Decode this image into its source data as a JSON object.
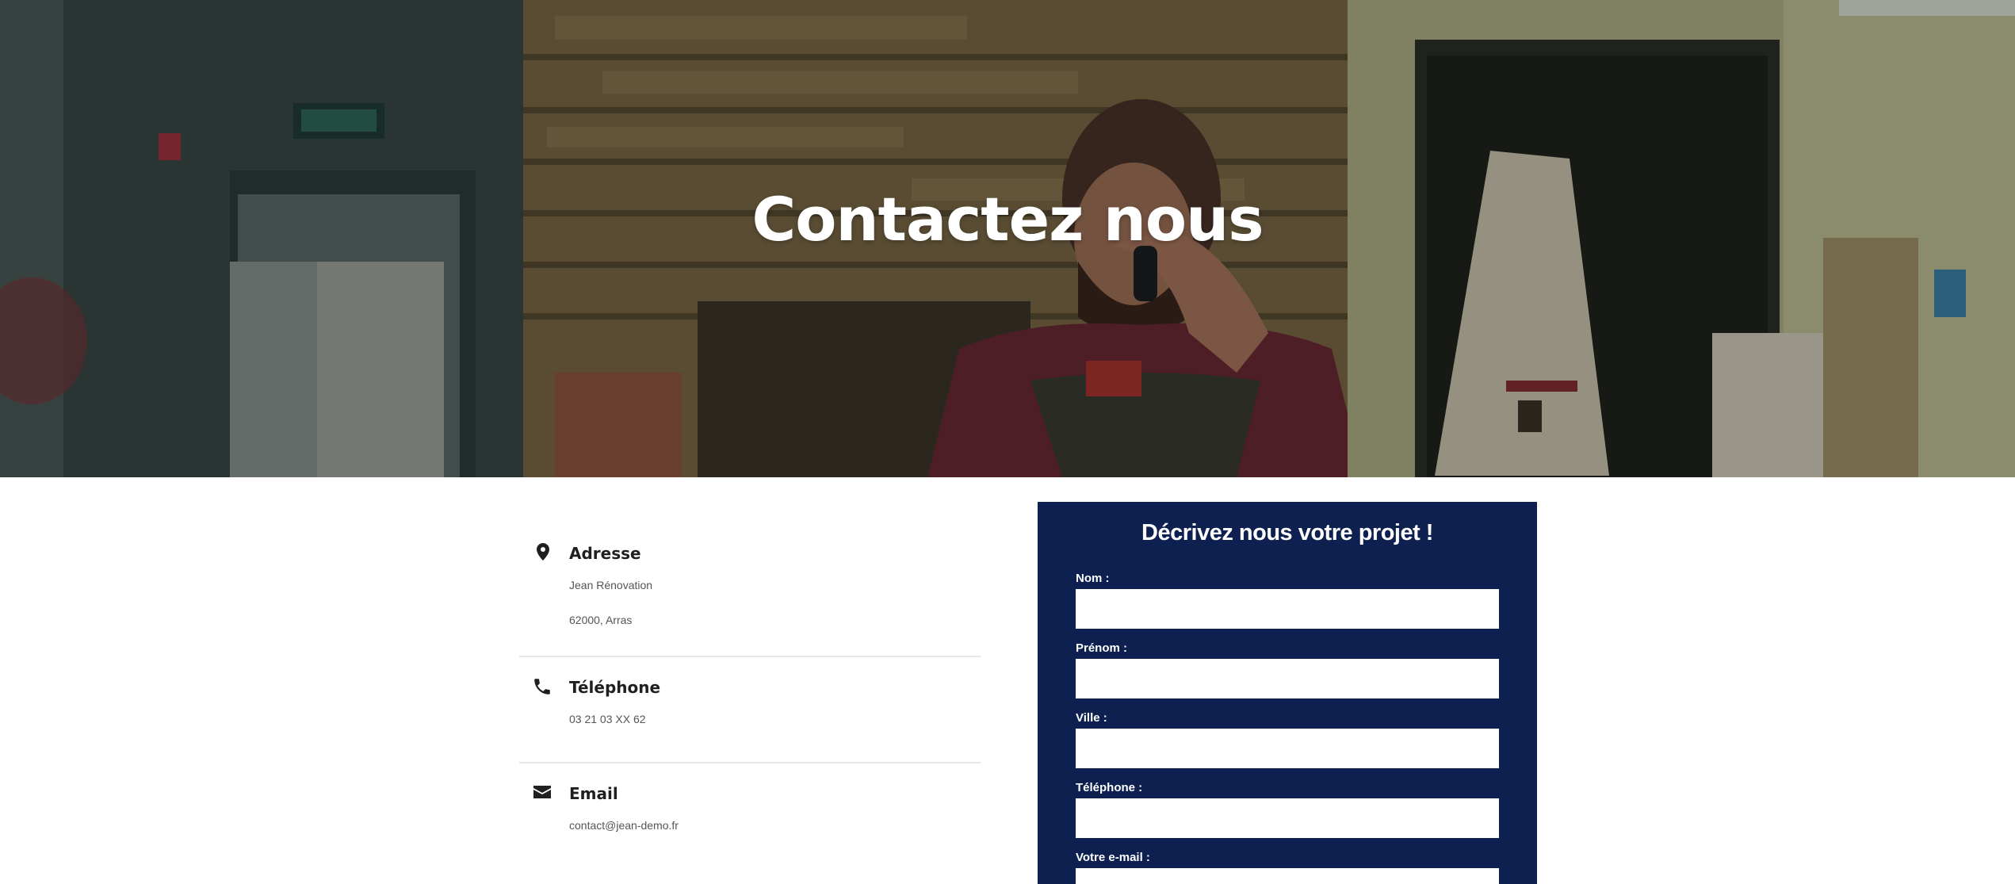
{
  "hero": {
    "title": "Contactez nous"
  },
  "contact": {
    "address": {
      "icon": "map-pin-icon",
      "title": "Adresse",
      "line1": "Jean Rénovation",
      "line2": "62000, Arras"
    },
    "phone": {
      "icon": "phone-icon",
      "title": "Téléphone",
      "value": "03 21 03 XX 62"
    },
    "email": {
      "icon": "envelope-icon",
      "title": "Email",
      "value": "contact@jean-demo.fr"
    }
  },
  "form": {
    "title": "Décrivez nous votre projet !",
    "fields": [
      {
        "label": "Nom :",
        "value": ""
      },
      {
        "label": "Prénom :",
        "value": ""
      },
      {
        "label": "Ville :",
        "value": ""
      },
      {
        "label": "Téléphone :",
        "value": ""
      },
      {
        "label": "Votre e-mail :",
        "value": ""
      }
    ]
  },
  "colors": {
    "form_background": "#0d2050",
    "text_dark": "#1f1f1f",
    "text_muted": "#555555"
  }
}
